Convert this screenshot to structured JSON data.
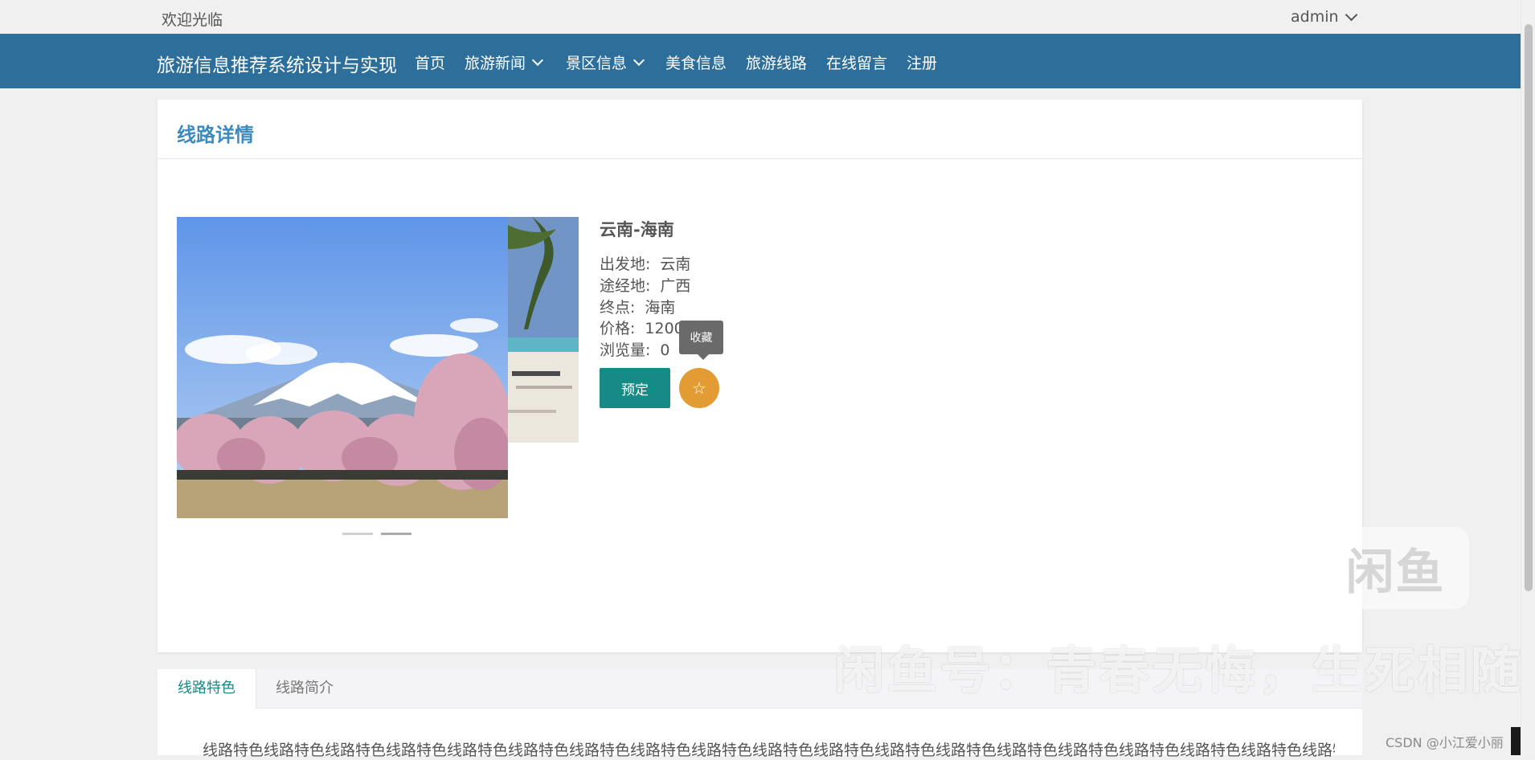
{
  "topbar": {
    "welcome": "欢迎光临",
    "user": "admin"
  },
  "navbar": {
    "brand": "旅游信息推荐系统设计与实现",
    "items": [
      {
        "label": "首页",
        "dropdown": false
      },
      {
        "label": "旅游新闻",
        "dropdown": true
      },
      {
        "label": "景区信息",
        "dropdown": true
      },
      {
        "label": "美食信息",
        "dropdown": false
      },
      {
        "label": "旅游线路",
        "dropdown": false
      },
      {
        "label": "在线留言",
        "dropdown": false
      },
      {
        "label": "注册",
        "dropdown": false
      }
    ]
  },
  "detail": {
    "title": "线路详情",
    "trip": {
      "name": "云南-海南",
      "fields": [
        {
          "label": "出发地:",
          "value": "云南"
        },
        {
          "label": "途经地:",
          "value": "广西"
        },
        {
          "label": "终点:",
          "value": "海南"
        },
        {
          "label": "价格:",
          "value": "1200"
        },
        {
          "label": "浏览量:",
          "value": "0"
        }
      ]
    },
    "book_button": "预定",
    "favorite_tooltip": "收藏",
    "carousel": {
      "slide_count": 2,
      "active_index": 1
    }
  },
  "tabs": {
    "items": [
      {
        "label": "线路特色",
        "active": true
      },
      {
        "label": "线路简介",
        "active": false
      }
    ],
    "content": "线路特色线路特色线路特色线路特色线路特色线路特色线路特色线路特色线路特色线路特色线路特色线路特色线路特色线路特色线路特色线路特色线路特色线路特色线路特色线路特色线路特"
  },
  "watermarks": {
    "logo": "闲鱼",
    "text": "闲鱼号：青春无悔，生死相随",
    "csdn": "CSDN @小江爱小丽"
  },
  "colors": {
    "nav_bg": "#2d6e9a",
    "title_blue": "#3b8bbd",
    "teal": "#168b86",
    "orange": "#e39b33",
    "page_bg": "#f0f0f0"
  }
}
